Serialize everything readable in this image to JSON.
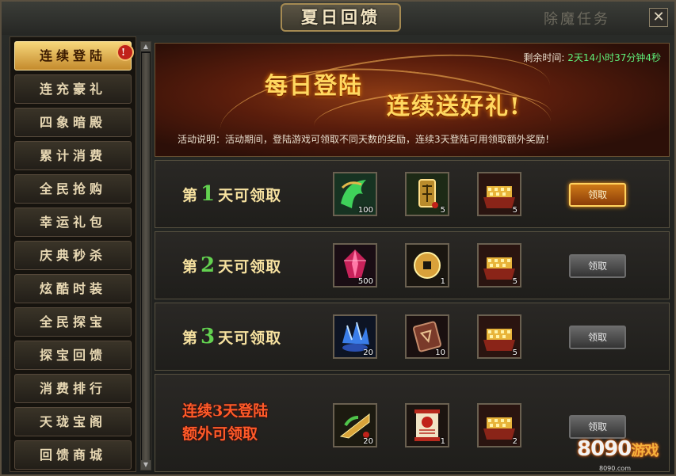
{
  "window": {
    "title": "夏日回馈",
    "background_tab": "除魔任务",
    "close_icon": "close-icon"
  },
  "nav": {
    "badge": "!",
    "items": [
      {
        "label": "连续登陆",
        "active": true
      },
      {
        "label": "连充豪礼"
      },
      {
        "label": "四象暗殿"
      },
      {
        "label": "累计消费"
      },
      {
        "label": "全民抢购"
      },
      {
        "label": "幸运礼包"
      },
      {
        "label": "庆典秒杀"
      },
      {
        "label": "炫酷时装"
      },
      {
        "label": "全民探宝"
      },
      {
        "label": "探宝回馈"
      },
      {
        "label": "消费排行"
      },
      {
        "label": "天珑宝阁"
      },
      {
        "label": "回馈商城"
      }
    ]
  },
  "banner": {
    "timer_label": "剩余时间:",
    "timer_value": "2天14小时37分钟4秒",
    "title_1": "每日登陆",
    "title_2": "连续送好礼!",
    "description": "活动说明：活动期间，登陆游戏可领取不同天数的奖励，连续3天登陆可用领取额外奖励！"
  },
  "rows": [
    {
      "prefix": "第",
      "day": "1",
      "suffix": "天可领取",
      "button": "领取",
      "button_style": "highlighted",
      "items": [
        {
          "icon": "green-jade-dragon-icon",
          "qty": "100"
        },
        {
          "icon": "gold-talisman-icon",
          "qty": "5"
        },
        {
          "icon": "gold-treasure-chest-icon",
          "qty": "5"
        }
      ]
    },
    {
      "prefix": "第",
      "day": "2",
      "suffix": "天可领取",
      "button": "领取",
      "button_style": "normal",
      "items": [
        {
          "icon": "red-crystal-icon",
          "qty": "500"
        },
        {
          "icon": "copper-coin-icon",
          "qty": "1"
        },
        {
          "icon": "gold-treasure-chest-icon",
          "qty": "5"
        }
      ]
    },
    {
      "prefix": "第",
      "day": "3",
      "suffix": "天可领取",
      "button": "领取",
      "button_style": "normal",
      "items": [
        {
          "icon": "blue-crystal-icon",
          "qty": "20"
        },
        {
          "icon": "rune-scroll-icon",
          "qty": "10"
        },
        {
          "icon": "gold-treasure-chest-icon",
          "qty": "5"
        }
      ]
    }
  ],
  "bonus_row": {
    "line_1": "连续3天登陆",
    "line_2": "额外可领取",
    "button": "领取",
    "items": [
      {
        "icon": "golden-fan-icon",
        "qty": "20"
      },
      {
        "icon": "red-scroll-icon",
        "qty": "1"
      },
      {
        "icon": "gold-treasure-chest-icon",
        "qty": "2"
      }
    ]
  },
  "watermark": {
    "brand": "8090",
    "brand_suffix": "游戏",
    "url": "8090.com"
  },
  "colors": {
    "accent_gold": "#f7d77b",
    "timer_green": "#5ff07a",
    "day_number_green": "#63d250",
    "bonus_red": "#ff5a28"
  }
}
